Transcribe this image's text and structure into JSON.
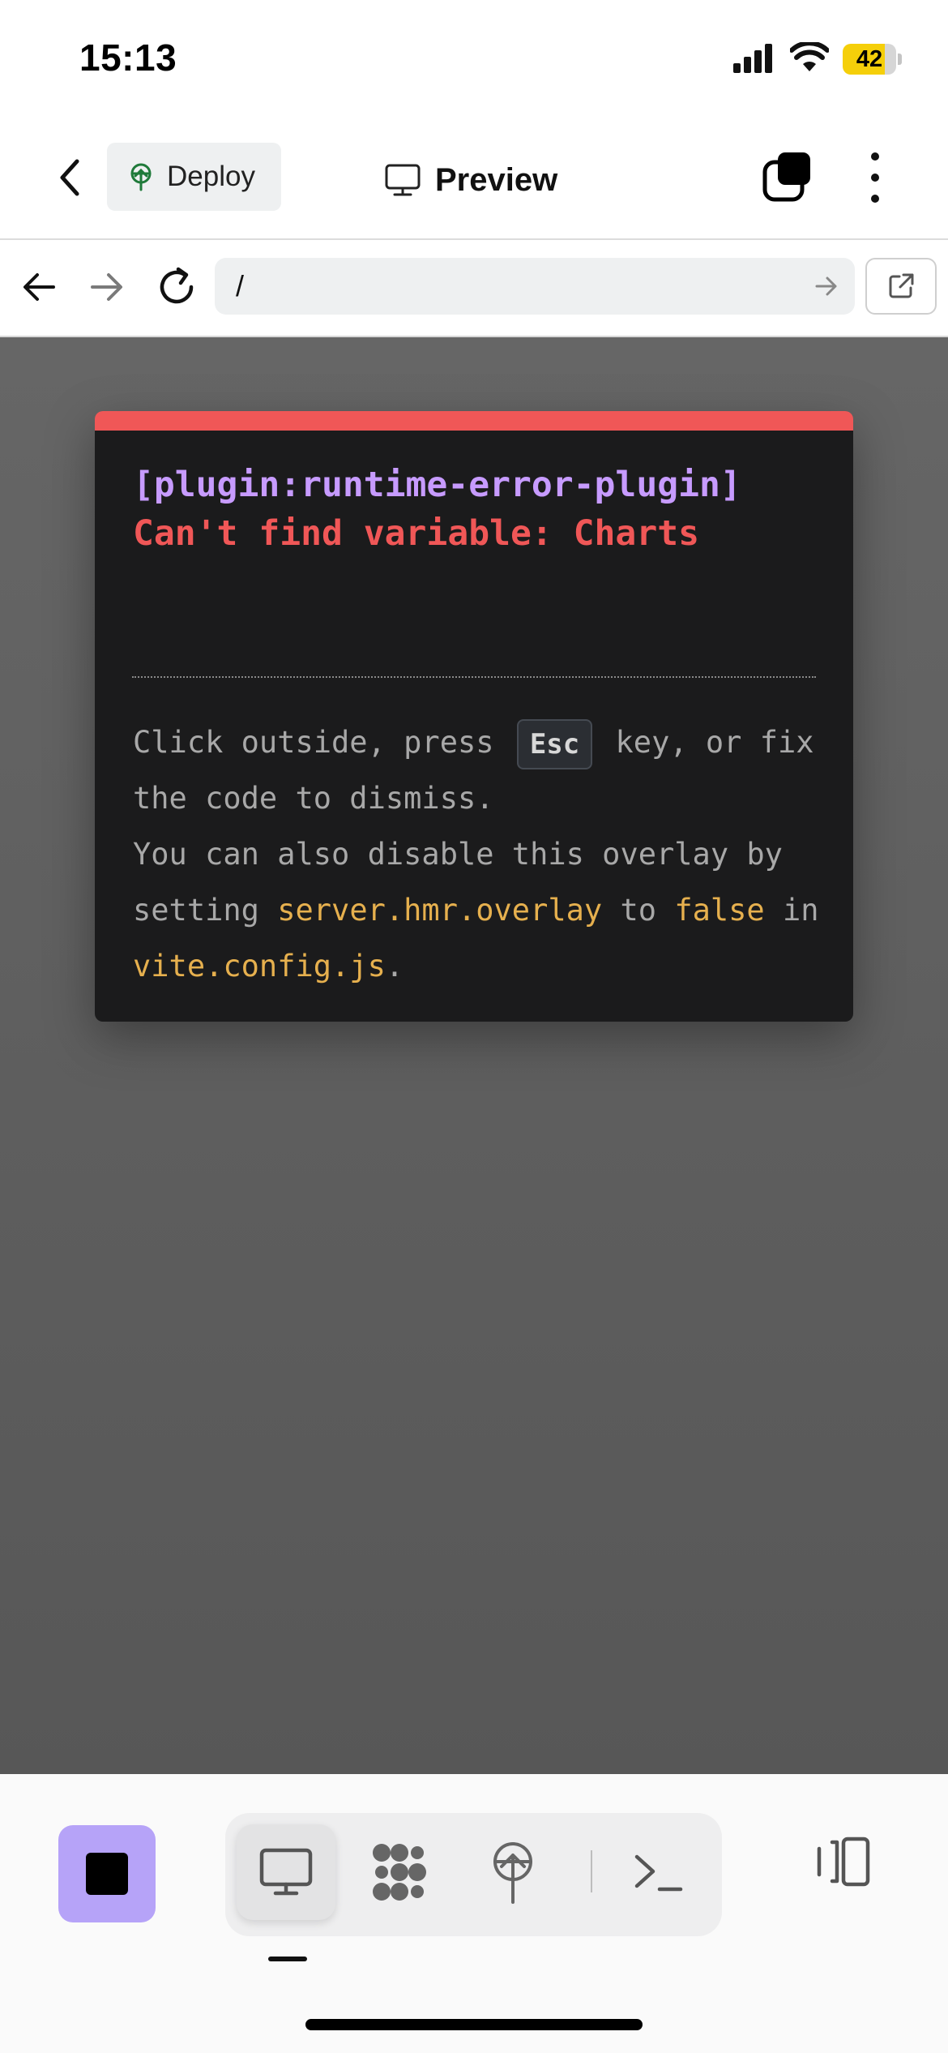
{
  "status_bar": {
    "time": "15:13",
    "battery_percent": "42",
    "icons": [
      "signal-icon",
      "wifi-icon",
      "battery-icon"
    ]
  },
  "topbar": {
    "back_icon": "chevron-left-icon",
    "deploy_label": "Deploy",
    "deploy_icon": "deploy-tree-icon",
    "preview_label": "Preview",
    "preview_icon": "monitor-icon",
    "tabs_icon": "stacked-squares-icon",
    "more_icon": "vertical-ellipsis-icon"
  },
  "urlbar": {
    "url": "/",
    "icons": [
      "arrow-left-icon",
      "arrow-right-icon",
      "reload-icon",
      "go-arrow-icon",
      "external-link-icon"
    ]
  },
  "error_overlay": {
    "plugin": "[plugin:runtime-error-plugin]",
    "message": "Can't find variable: Charts",
    "tip_part1": "Click outside, press",
    "tip_key": "Esc",
    "tip_part2": "key, or fix the code to dismiss.",
    "tip_part3": "You can also disable this overlay by setting",
    "tip_code1": "server.hmr.overlay",
    "tip_part4": "to",
    "tip_code2": "false",
    "tip_part5": "in",
    "tip_code3": "vite.config.js",
    "tip_part6": ".",
    "colors": {
      "accent_bar": "#f05757",
      "plugin_text": "#c79bff",
      "message_text": "#f05757",
      "code_text": "#e6b04e"
    }
  },
  "bottom_toolbar": {
    "stop_icon": "stop-square-icon",
    "stop_color": "#b6a3f8",
    "tools": [
      "monitor-icon",
      "workflow-icon",
      "deploy-tree-icon",
      "terminal-icon"
    ],
    "active_tool": "monitor-icon",
    "panel_icon": "side-panel-icon"
  }
}
